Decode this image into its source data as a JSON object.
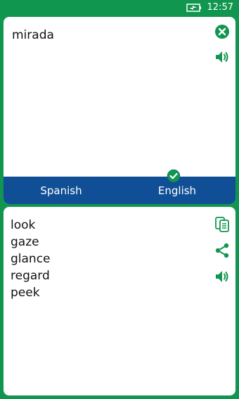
{
  "status_bar": {
    "time": "12:57",
    "battery_icon": "battery-charging-icon"
  },
  "source": {
    "text": "mirada",
    "icons": [
      "clear-icon",
      "speaker-icon"
    ]
  },
  "languages": {
    "from": "Spanish",
    "to": "English",
    "selected": "English"
  },
  "results": {
    "words": [
      "look",
      "gaze",
      "glance",
      "regard",
      "peek"
    ],
    "icons": [
      "copy-icon",
      "share-icon",
      "speaker-icon"
    ]
  },
  "colors": {
    "accent": "#11964f",
    "language_bar": "#104f95",
    "card": "#ffffff"
  }
}
